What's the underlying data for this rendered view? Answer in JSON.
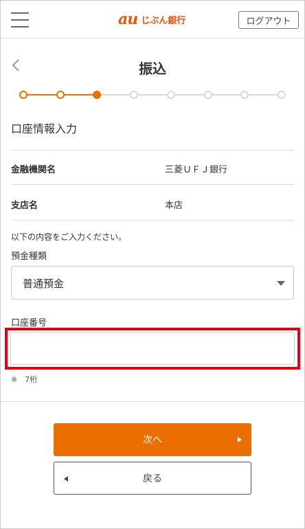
{
  "header": {
    "menu_icon": "hamburger-menu-icon",
    "logo_mark": "au",
    "logo_name": "じぶん銀行",
    "logout_label": "ログアウト"
  },
  "page": {
    "back_icon": "chevron-left-icon",
    "title": "振込"
  },
  "progress": {
    "total_steps": 8,
    "current_step": 3,
    "active_color": "#eb6f00",
    "inactive_color": "#d9d9d9"
  },
  "account_info": {
    "section_title": "口座情報入力",
    "rows": [
      {
        "label": "金融機関名",
        "value": "三菱ＵＦＪ銀行"
      },
      {
        "label": "支店名",
        "value": "本店"
      }
    ]
  },
  "form": {
    "instruction": "以下の内容をご入力ください。",
    "deposit_type_label": "預金種類",
    "deposit_type_value": "普通預金",
    "account_number_label": "口座番号",
    "account_number_value": "",
    "account_number_placeholder": "",
    "account_number_note": "※　7桁",
    "highlight_color": "#e60012"
  },
  "buttons": {
    "next_label": "次へ",
    "back_label": "戻る"
  },
  "colors": {
    "brand": "#eb5505",
    "primary_button": "#eb6f00"
  }
}
